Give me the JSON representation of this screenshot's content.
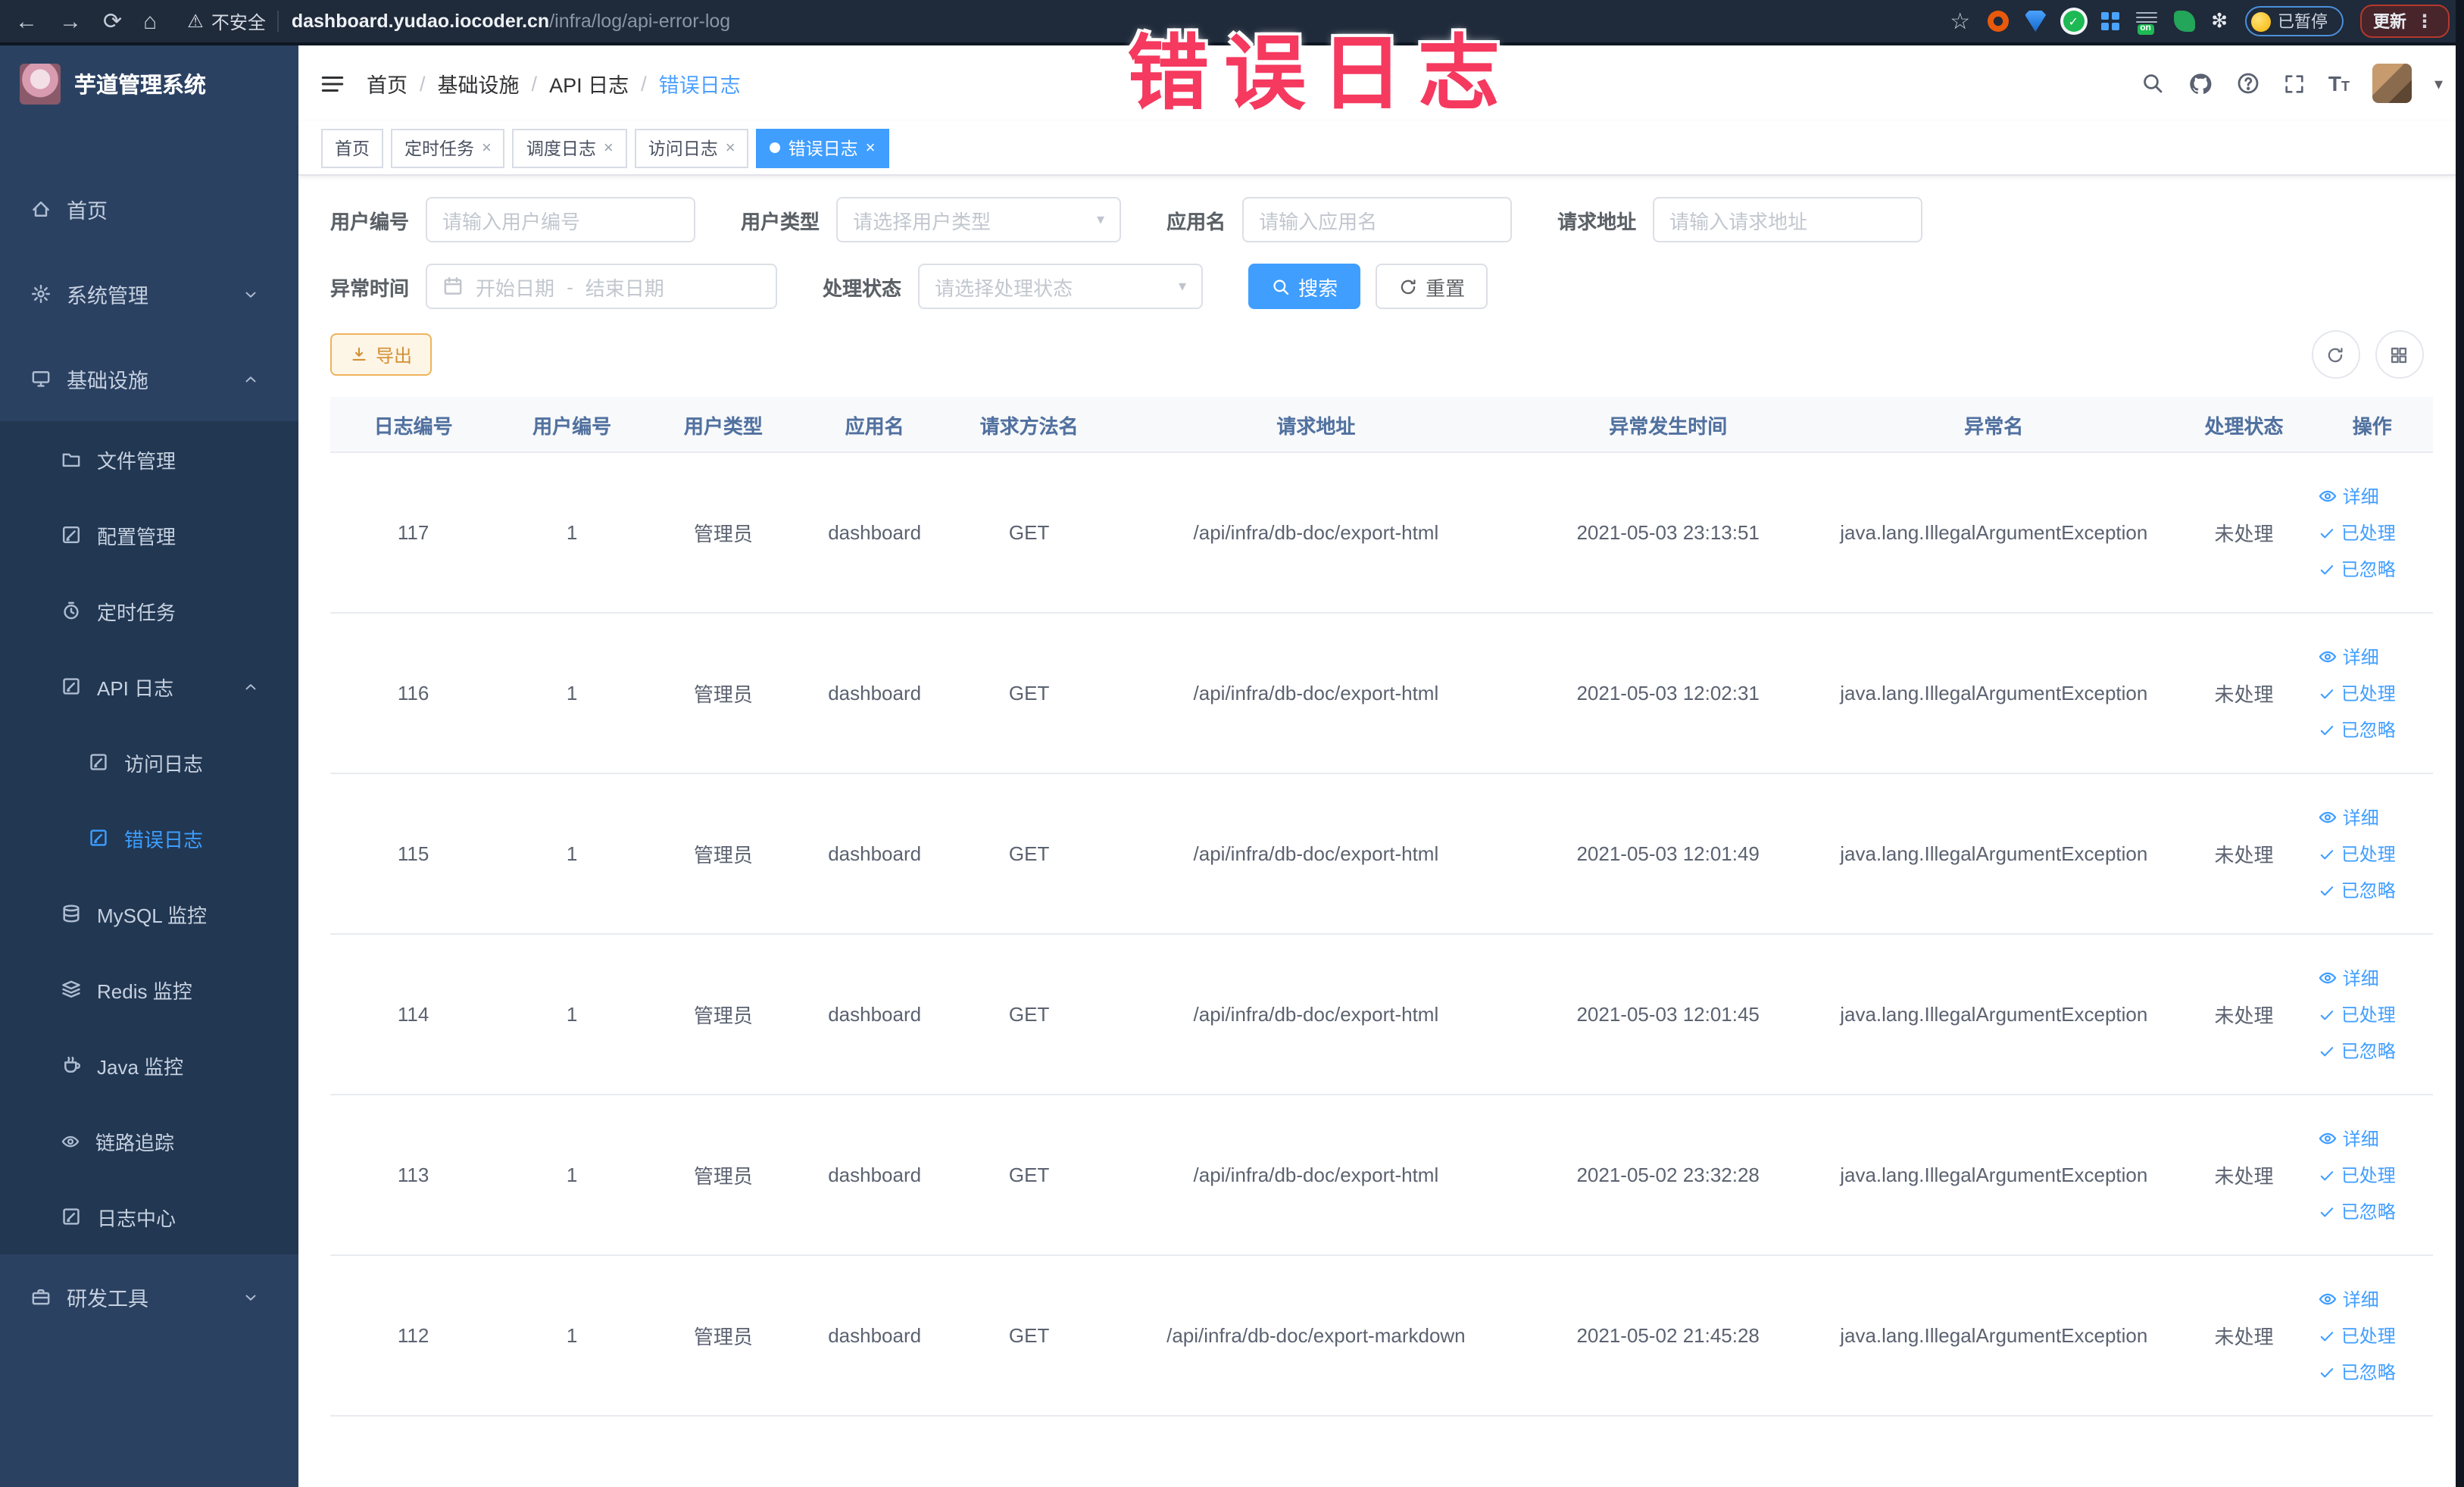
{
  "browser": {
    "security_label": "不安全",
    "url_host": "dashboard.yudao.iocoder.cn",
    "url_path": "/infra/log/api-error-log",
    "paused_label": "已暂停",
    "update_label": "更新"
  },
  "overlay": {
    "text": "错误日志",
    "color": "#f5395f"
  },
  "app": {
    "title": "芋道管理系统"
  },
  "breadcrumb": [
    "首页",
    "基础设施",
    "API 日志",
    "错误日志"
  ],
  "tabs": [
    {
      "label": "首页",
      "closable": false,
      "active": false
    },
    {
      "label": "定时任务",
      "closable": true,
      "active": false
    },
    {
      "label": "调度日志",
      "closable": true,
      "active": false
    },
    {
      "label": "访问日志",
      "closable": true,
      "active": false
    },
    {
      "label": "错误日志",
      "closable": true,
      "active": true
    }
  ],
  "sidebar": {
    "items": [
      {
        "label": "首页",
        "icon": "home-icon",
        "level": 1
      },
      {
        "label": "系统管理",
        "icon": "gear-icon",
        "level": 1,
        "chevron": "down"
      },
      {
        "label": "基础设施",
        "icon": "infra-icon",
        "level": 1,
        "chevron": "up"
      },
      {
        "label": "文件管理",
        "icon": "folder-icon",
        "level": 2,
        "submenu": true
      },
      {
        "label": "配置管理",
        "icon": "config-icon",
        "level": 2,
        "submenu": true
      },
      {
        "label": "定时任务",
        "icon": "timer-icon",
        "level": 2,
        "submenu": true
      },
      {
        "label": "API 日志",
        "icon": "doc-edit-icon",
        "level": 2,
        "submenu": true,
        "chevron": "up"
      },
      {
        "label": "访问日志",
        "icon": "doc-edit-icon",
        "level": 3,
        "submenu": true
      },
      {
        "label": "错误日志",
        "icon": "doc-edit-icon",
        "level": 3,
        "submenu": true,
        "active": true
      },
      {
        "label": "MySQL 监控",
        "icon": "database-icon",
        "level": 2,
        "submenu": true
      },
      {
        "label": "Redis 监控",
        "icon": "layers-icon",
        "level": 2,
        "submenu": true
      },
      {
        "label": "Java 监控",
        "icon": "coffee-icon",
        "level": 2,
        "submenu": true
      },
      {
        "label": "链路追踪",
        "icon": "eye-icon",
        "level": 2,
        "submenu": true
      },
      {
        "label": "日志中心",
        "icon": "doc-edit-icon",
        "level": 2,
        "submenu": true
      },
      {
        "label": "研发工具",
        "icon": "briefcase-icon",
        "level": 1,
        "chevron": "down"
      }
    ]
  },
  "filters": {
    "user_id": {
      "label": "用户编号",
      "placeholder": "请输入用户编号"
    },
    "user_type": {
      "label": "用户类型",
      "placeholder": "请选择用户类型"
    },
    "app_name": {
      "label": "应用名",
      "placeholder": "请输入应用名"
    },
    "request_url": {
      "label": "请求地址",
      "placeholder": "请输入请求地址"
    },
    "exception_time": {
      "label": "异常时间",
      "start_placeholder": "开始日期",
      "separator": "-",
      "end_placeholder": "结束日期"
    },
    "process_status": {
      "label": "处理状态",
      "placeholder": "请选择处理状态"
    },
    "search_label": "搜索",
    "reset_label": "重置"
  },
  "toolbar": {
    "export_label": "导出"
  },
  "table": {
    "columns": [
      "日志编号",
      "用户编号",
      "用户类型",
      "应用名",
      "请求方法名",
      "请求地址",
      "异常发生时间",
      "异常名",
      "处理状态",
      "操作"
    ],
    "actions": [
      "详细",
      "已处理",
      "已忽略"
    ],
    "rows": [
      {
        "id": "117",
        "user_id": "1",
        "user_type": "管理员",
        "app": "dashboard",
        "method": "GET",
        "url": "/api/infra/db-doc/export-html",
        "time": "2021-05-03 23:13:51",
        "exception": "java.lang.IllegalArgumentException",
        "status": "未处理"
      },
      {
        "id": "116",
        "user_id": "1",
        "user_type": "管理员",
        "app": "dashboard",
        "method": "GET",
        "url": "/api/infra/db-doc/export-html",
        "time": "2021-05-03 12:02:31",
        "exception": "java.lang.IllegalArgumentException",
        "status": "未处理"
      },
      {
        "id": "115",
        "user_id": "1",
        "user_type": "管理员",
        "app": "dashboard",
        "method": "GET",
        "url": "/api/infra/db-doc/export-html",
        "time": "2021-05-03 12:01:49",
        "exception": "java.lang.IllegalArgumentException",
        "status": "未处理"
      },
      {
        "id": "114",
        "user_id": "1",
        "user_type": "管理员",
        "app": "dashboard",
        "method": "GET",
        "url": "/api/infra/db-doc/export-html",
        "time": "2021-05-03 12:01:45",
        "exception": "java.lang.IllegalArgumentException",
        "status": "未处理"
      },
      {
        "id": "113",
        "user_id": "1",
        "user_type": "管理员",
        "app": "dashboard",
        "method": "GET",
        "url": "/api/infra/db-doc/export-html",
        "time": "2021-05-02 23:32:28",
        "exception": "java.lang.IllegalArgumentException",
        "status": "未处理"
      },
      {
        "id": "112",
        "user_id": "1",
        "user_type": "管理员",
        "app": "dashboard",
        "method": "GET",
        "url": "/api/infra/db-doc/export-markdown",
        "time": "2021-05-02 21:45:28",
        "exception": "java.lang.IllegalArgumentException",
        "status": "未处理"
      }
    ]
  },
  "colors": {
    "accent_blue": "#409eff",
    "link_blue": "#409eff",
    "sidebar_bg": "#2b4162",
    "sidebar_submenu_bg": "#223752",
    "active_menu_text": "#3d9eff",
    "warning_orange": "#d29034",
    "overlay_pink": "#f5395f",
    "browser_bar_bg": "#1f2a3a",
    "table_header_text": "#51719f",
    "table_header_bg": "#f8f9fb"
  }
}
